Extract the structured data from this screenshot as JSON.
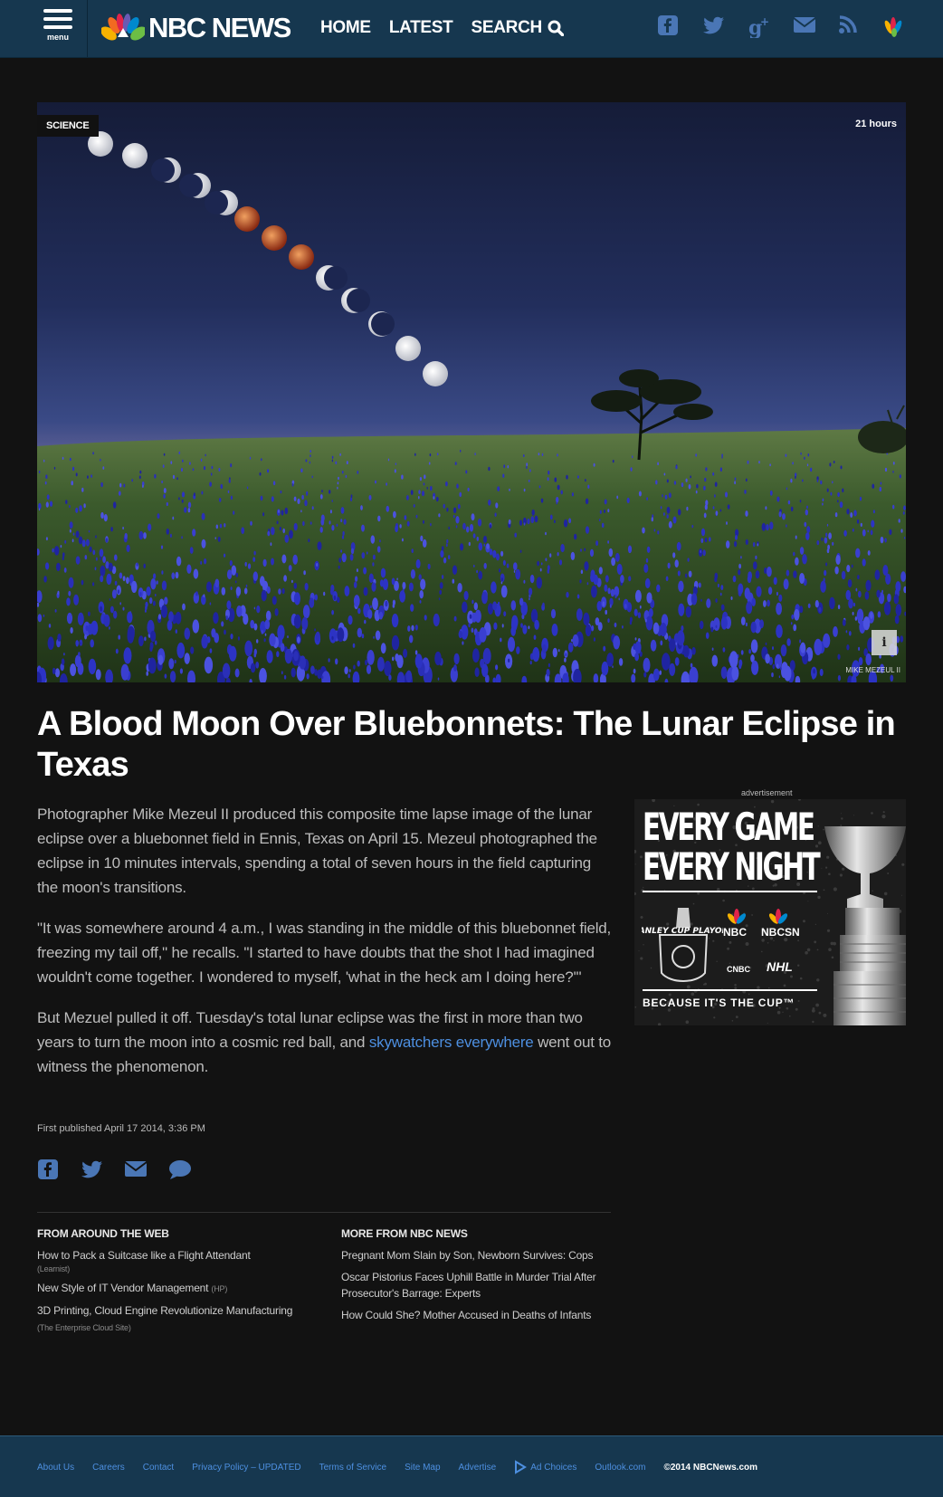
{
  "header": {
    "menu_label": "menu",
    "logo_text": "NBC NEWS",
    "nav": [
      "HOME",
      "LATEST",
      "SEARCH"
    ],
    "social_icons": [
      "facebook-icon",
      "twitter-icon",
      "google-plus-icon",
      "email-icon",
      "rss-icon",
      "peacock-icon"
    ]
  },
  "hero": {
    "section_tag": "SCIENCE",
    "time_ago": "21 hours",
    "info_label": "i",
    "credit": "MIKE MEZEUL II"
  },
  "article": {
    "headline": "A Blood Moon Over Bluebonnets: The Lunar Eclipse in Texas",
    "p1": "Photographer Mike Mezeul II produced this composite time lapse image of the lunar eclipse over a bluebonnet field in Ennis, Texas on April 15. Mezeul photographed the eclipse in 10 minutes intervals, spending a total of seven hours in the field capturing the moon's transitions.",
    "p2": "\"It was somewhere around 4 a.m., I was standing in the middle of this bluebonnet field, freezing my tail off,\" he recalls. \"I started to have doubts that the shot I had imagined wouldn't come together. I wondered to myself, 'what in the heck am I doing here?'\"",
    "p3_before": "But Mezuel pulled it off. Tuesday's total lunar eclipse was the first in more than two years to turn the moon into a cosmic red ball, and ",
    "p3_link": "skywatchers everywhere",
    "p3_after": " went out to witness the phenomenon.",
    "published": "First published April 17 2014, 3:36 PM",
    "share_icons": [
      "facebook-icon",
      "twitter-icon",
      "email-icon",
      "comment-icon"
    ]
  },
  "around_web": {
    "title": "FROM AROUND THE WEB",
    "items": [
      {
        "text": "How to Pack a Suitcase like a Flight Attendant",
        "source": "(Learnist)"
      },
      {
        "text": "New Style of IT Vendor Management",
        "source": "(HP)"
      },
      {
        "text": "3D Printing, Cloud Engine Revolutionize Manufacturing",
        "source": "(The Enterprise Cloud Site)"
      }
    ]
  },
  "more_nbc": {
    "title": "MORE FROM NBC NEWS",
    "items": [
      "Pregnant Mom Slain by Son, Newborn Survives: Cops",
      "Oscar Pistorius Faces Uphill Battle in Murder Trial After Prosecutor's Barrage: Experts",
      "How Could She? Mother Accused in Deaths of Infants"
    ]
  },
  "ad": {
    "label": "advertisement",
    "line1": "EVERY GAME",
    "line2": "EVERY NIGHT",
    "stanley": "STANLEY CUP PLAYOFFS",
    "brands": [
      "NBC",
      "NBCSN",
      "CNBC",
      "NHL"
    ],
    "tagline": "BECAUSE IT'S THE CUP™"
  },
  "footer": {
    "links": [
      "About Us",
      "Careers",
      "Contact",
      "Privacy Policy – UPDATED",
      "Terms of Service",
      "Site Map",
      "Advertise",
      "Ad Choices",
      "Outlook.com"
    ],
    "copyright": "©2014 NBCNews.com"
  },
  "colors": {
    "header_bg": "#16374f",
    "page_bg": "#121212",
    "link": "#4d8fe0"
  }
}
